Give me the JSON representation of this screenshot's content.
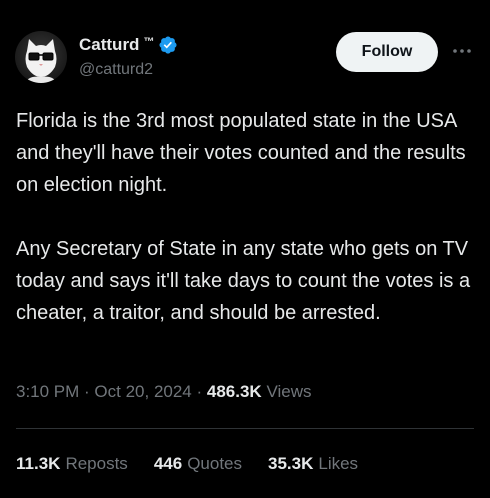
{
  "author": {
    "display_name": "Catturd",
    "trademark": "™",
    "handle": "@catturd2",
    "verified_color": "#1d9bf0"
  },
  "actions": {
    "follow_label": "Follow",
    "more_icon": "ellipsis-icon"
  },
  "tweet": {
    "text": "Florida is the 3rd most populated state in the USA and they'll have their votes counted and the results on election night.\n\nAny Secretary of State in any state who gets on TV today and says it'll take days to count the votes is a cheater, a traitor, and should be arrested."
  },
  "meta": {
    "time": "3:10 PM",
    "sep1": " · ",
    "date": "Oct 20, 2024",
    "sep2": " · ",
    "views_count": "486.3K",
    "views_label": "Views"
  },
  "stats": {
    "reposts_count": "11.3K",
    "reposts_label": "Reposts",
    "quotes_count": "446",
    "quotes_label": "Quotes",
    "likes_count": "35.3K",
    "likes_label": "Likes"
  }
}
